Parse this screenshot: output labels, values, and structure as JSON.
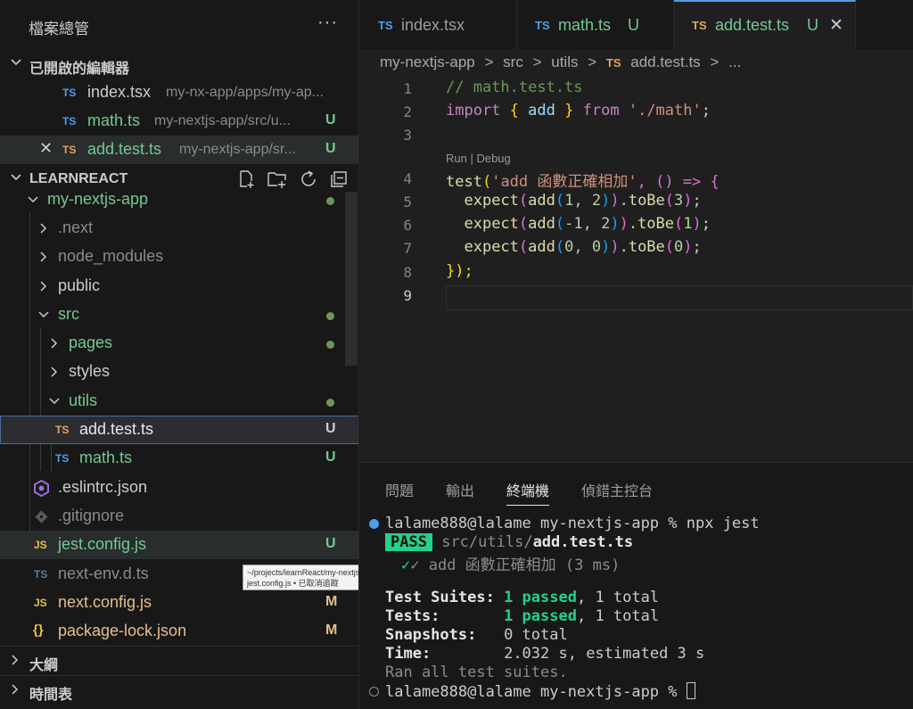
{
  "sidebar": {
    "title": "檔案總管",
    "more": "···",
    "open_editors": {
      "label": "已開啟的編輯器",
      "items": [
        {
          "icon": "TS",
          "name": "index.tsx",
          "path": "my-nx-app/apps/my-ap...",
          "badge": ""
        },
        {
          "icon": "TS",
          "name": "math.ts",
          "path": "my-nextjs-app/src/u...",
          "badge": "U"
        },
        {
          "icon": "TS",
          "close": "✕",
          "name": "add.test.ts",
          "path": "my-nextjs-app/sr...",
          "badge": "U"
        }
      ]
    },
    "workspace": {
      "label": "LEARNREACT",
      "tree": [
        {
          "label": "my-nextjs-app"
        },
        {
          "label": ".next"
        },
        {
          "label": "node_modules"
        },
        {
          "label": "public"
        },
        {
          "label": "src"
        },
        {
          "label": "pages"
        },
        {
          "label": "styles"
        },
        {
          "label": "utils"
        },
        {
          "icon": "TS",
          "label": "add.test.ts",
          "badge": "U"
        },
        {
          "icon": "TS",
          "label": "math.ts",
          "badge": "U"
        },
        {
          "label": ".eslintrc.json"
        },
        {
          "label": ".gitignore"
        },
        {
          "icon": "JS",
          "label": "jest.config.js",
          "badge": "U"
        },
        {
          "icon": "TS",
          "label": "next-env.d.ts"
        },
        {
          "icon": "JS",
          "label": "next.config.js",
          "badge": "M"
        },
        {
          "icon": "{}",
          "label": "package-lock.json",
          "badge": "M"
        }
      ]
    },
    "tooltip": {
      "line1": "~/projects/learnReact/my-nextjs-app/",
      "line2": "jest.config.js • 已取消追蹤"
    },
    "outline": "大綱",
    "timeline": "時間表"
  },
  "editor": {
    "tabs": [
      {
        "icon": "TS",
        "name": "index.tsx",
        "badge": ""
      },
      {
        "icon": "TS",
        "name": "math.ts",
        "badge": "U"
      },
      {
        "icon": "TS",
        "name": "add.test.ts",
        "badge": "U",
        "close": "✕"
      }
    ],
    "breadcrumb": [
      "my-nextjs-app",
      ">",
      "src",
      ">",
      "utils",
      ">",
      "TS",
      "add.test.ts",
      ">",
      "..."
    ],
    "codelens": "Run | Debug",
    "line_numbers": [
      "1",
      "2",
      "3",
      "4",
      "5",
      "6",
      "7",
      "8",
      "9"
    ],
    "code": {
      "l1": "// math.test.ts",
      "l2_import": "import",
      "l2_open": "{",
      "l2_name": "add",
      "l2_close": "}",
      "l2_from": "from",
      "l2_path": "'./math'",
      "l2_semi": ";",
      "l4_fn": "test",
      "l4_str": "'add 函數正確相加'",
      "l4_rest": ", () => {",
      "expect": "expect",
      "add": "add",
      "toBe": "toBe",
      "l5_args": "1, 2",
      "l5_val": "3",
      "l6_args": "-1, 2",
      "l6_val": "1",
      "l7_args": "0, 0",
      "l7_val": "0",
      "l8": "});"
    }
  },
  "panel": {
    "tabs": [
      "問題",
      "輸出",
      "終端機",
      "偵錯主控台"
    ],
    "terminal": {
      "prompt1": "lalame888@lalame my-nextjs-app % npx jest",
      "pass": "PASS",
      "test_dir": "src/utils/",
      "test_file": "add.test.ts",
      "check_line": "✓ add 函數正確相加 (3 ms)",
      "suites_label": "Test Suites:",
      "suites_passed": "1 passed",
      "suites_total": ", 1 total",
      "tests_label": "Tests:",
      "tests_passed": "1 passed",
      "tests_total": ", 1 total",
      "snapshots_label": "Snapshots:",
      "snapshots_value": "0 total",
      "time_label": "Time:",
      "time_value": "2.032 s, estimated 3 s",
      "ran": "Ran all test suites.",
      "prompt2": "lalame888@lalame my-nextjs-app % "
    }
  },
  "colors": {
    "ts": "#4d9ee8",
    "js": "#e8c33d",
    "untracked": "#73c991",
    "modified": "#e2c08d",
    "accent": "#4d9ee8"
  }
}
